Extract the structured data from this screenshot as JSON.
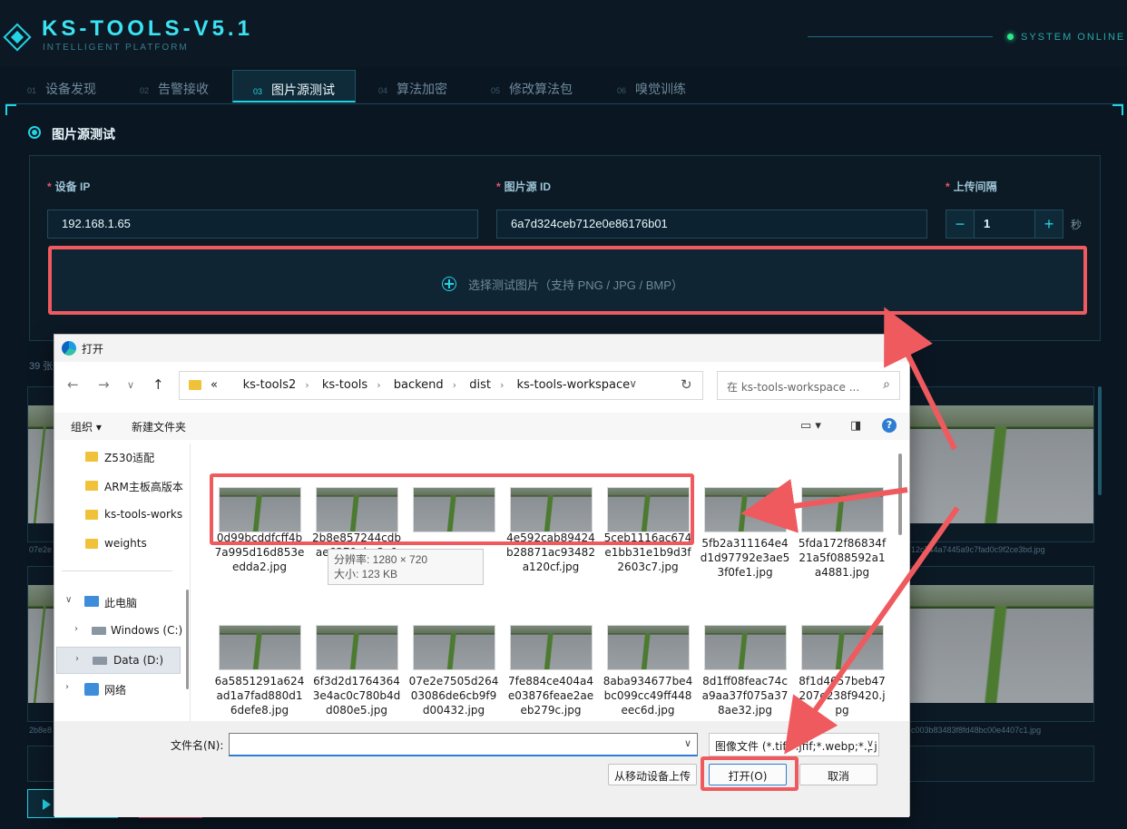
{
  "app": {
    "title": "KS-TOOLS-V5.1",
    "subtitle": "INTELLIGENT PLATFORM",
    "status": "SYSTEM ONLINE"
  },
  "tabs": [
    {
      "num": "01",
      "label": "设备发现"
    },
    {
      "num": "02",
      "label": "告警接收"
    },
    {
      "num": "03",
      "label": "图片源测试"
    },
    {
      "num": "04",
      "label": "算法加密"
    },
    {
      "num": "05",
      "label": "修改算法包"
    },
    {
      "num": "06",
      "label": "嗅觉训练"
    }
  ],
  "active_tab": "图片源测试",
  "section": {
    "title": "图片源测试"
  },
  "form": {
    "device_ip_label": "设备 IP",
    "device_ip_value": "192.168.1.65",
    "source_id_label": "图片源 ID",
    "source_id_value": "6a7d324ceb712e0e86176b01",
    "interval_label": "上传间隔",
    "interval_value": "1",
    "interval_unit": "秒",
    "required_mark": "*",
    "minus": "−",
    "plus": "+"
  },
  "upload": {
    "text": "选择测试图片（支持 PNG / JPG / BMP）"
  },
  "gallery": {
    "count_text": "39 张",
    "captions": [
      "07e2e",
      "2b8e8",
      "12c744a7445a9c7fad0c9f2ce3bd.jpg",
      "c003b83483f8fd48bc00e4407c1.jpg"
    ]
  },
  "dialog": {
    "title": "打开",
    "breadcrumb": [
      "«",
      "ks-tools2",
      "ks-tools",
      "backend",
      "dist",
      "ks-tools-workspace"
    ],
    "search_placeholder": "在 ks-tools-workspace ...",
    "organize": "组织 ▾",
    "new_folder": "新建文件夹",
    "nav_items": [
      "Z530适配",
      "ARM主板高版本",
      "ks-tools-works",
      "weights",
      "此电脑",
      "Windows (C:)",
      "Data (D:)",
      "网络"
    ],
    "files_row1": [
      "0d99bcddfcff4b7a995d16d853eedda2.jpg",
      "2b8e857244cdbae6379ebe3a94.jpg",
      "4e592cab894244fb28871ac93482a120cf.jpg",
      "5ceb1116ac674e1bb31e1b9d3f2603c7.jpg",
      "4e5c2ab89424b28871ac93482a120cf.jpg",
      "5fb2a311164e4d1d97792e3ae53f0fe1.jpg",
      "5fda172f86834f21a5f088592a1a4881.jpg"
    ],
    "files_row1_visible": [
      "0d99bcddfcff4b7a995d16d853eedda2.jpg",
      "2b8e857244cdbae6379ebe3a94.jpg",
      "4e592cab89424b28871ac93482a120cf.jpg",
      "5ceb1116ac674e1bb31e1b9d3f2603c7.jpg",
      "5fb2a311164e4d1d97792e3ae53f0fe1.jpg",
      "5fda172f86834f21a5f088592a1a4881.jpg"
    ],
    "files_row2": [
      "6a5851291a624ad1a7fad880d16defe8.jpg",
      "6f3d2d17643643e4ac0c780b4dd080e5.jpg",
      "07e2e7505d26403086de6cb9f9d00432.jpg",
      "7fe884ce404a4e03876feae2aeeb279c.jpg",
      "8aba934677be4bc099cc49ff448eec6d.jpg",
      "8d1ff08feac74ca9aa37f075a378ae32.jpg",
      "8f1d4657beb47207e238f9420.jpg"
    ],
    "tooltip_resolution": "分辨率: 1280 × 720",
    "tooltip_size": "大小: 123 KB",
    "filename_label": "文件名(N):",
    "filter": "图像文件 (*.tif;*.jfif;*.webp;*.pj",
    "mobile_upload": "从移动设备上传",
    "open": "打开(O)",
    "cancel": "取消"
  },
  "colors": {
    "accent": "#22d3e6",
    "annotation": "#ef5a5f",
    "required": "#f0556a"
  }
}
